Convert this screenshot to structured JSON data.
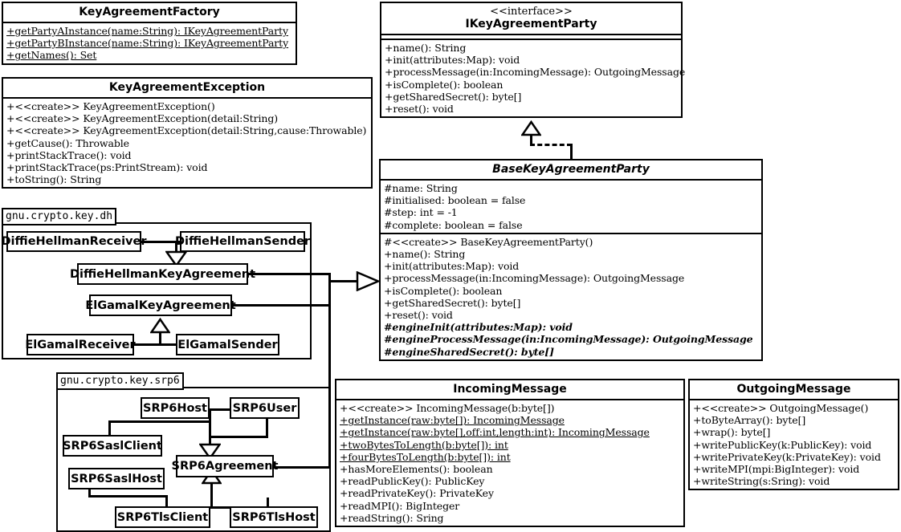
{
  "diagram": {
    "title": "GNU Crypto key agreement UML class diagram"
  },
  "classes": {
    "key_agreement_factory": {
      "name": "KeyAgreementFactory",
      "operations": [
        "+getPartyAInstance(name:String): IKeyAgreementParty",
        "+getPartyBInstance(name:String): IKeyAgreementParty",
        "+getNames(): Set"
      ]
    },
    "key_agreement_exception": {
      "name": "KeyAgreementException",
      "operations": [
        "+<<create>> KeyAgreementException()",
        "+<<create>> KeyAgreementException(detail:String)",
        "+<<create>> KeyAgreementException(detail:String,cause:Throwable)",
        "+getCause(): Throwable",
        "+printStackTrace(): void",
        "+printStackTrace(ps:PrintStream): void",
        "+toString(): String"
      ]
    },
    "ikey_agreement_party": {
      "stereotype": "<<interface>>",
      "name": "IKeyAgreementParty",
      "operations": [
        "+name(): String",
        "+init(attributes:Map): void",
        "+processMessage(in:IncomingMessage): OutgoingMessage",
        "+isComplete(): boolean",
        "+getSharedSecret(): byte[]",
        "+reset(): void"
      ]
    },
    "base_key_agreement_party": {
      "name": "BaseKeyAgreementParty",
      "attributes": [
        "#name: String",
        "#initialised: boolean = false",
        "#step: int = -1",
        "#complete: boolean = false"
      ],
      "operations": [
        "#<<create>> BaseKeyAgreementParty()",
        "+name(): String",
        "+init(attributes:Map): void",
        "+processMessage(in:IncomingMessage): OutgoingMessage",
        "+isComplete(): boolean",
        "+getSharedSecret(): byte[]",
        "+reset(): void",
        "#engineInit(attributes:Map): void",
        "#engineProcessMessage(in:IncomingMessage): OutgoingMessage",
        "#engineSharedSecret(): byte[]"
      ]
    },
    "incoming_message": {
      "name": "IncomingMessage",
      "operations": [
        "+<<create>> IncomingMessage(b:byte[])",
        "+getInstance(raw:byte[]): IncomingMessage",
        "+getInstance(raw:byte[],off:int,length:int): IncomingMessage",
        "+twoBytesToLength(b:byte[]): int",
        "+fourBytesToLength(b:byte[]): int",
        "+hasMoreElements(): boolean",
        "+readPublicKey(): PublicKey",
        "+readPrivateKey(): PrivateKey",
        "+readMPI(): BigInteger",
        "+readString(): Sring"
      ]
    },
    "outgoing_message": {
      "name": "OutgoingMessage",
      "operations": [
        "+<<create>> OutgoingMessage()",
        "+toByteArray(): byte[]",
        "+wrap(): byte[]",
        "+writePublicKey(k:PublicKey): void",
        "+writePrivateKey(k:PrivateKey): void",
        "+writeMPI(mpi:BigInteger): void",
        "+writeString(s:Sring): void"
      ]
    }
  },
  "packages": {
    "dh": {
      "label": "gnu.crypto.key.dh",
      "classes": {
        "diffie_hellman_receiver": "DiffieHellmanReceiver",
        "diffie_hellman_sender": "DiffieHellmanSender",
        "diffie_hellman_key_agreement": "DiffieHellmanKeyAgreement",
        "elgamal_key_agreement": "ElGamalKeyAgreement",
        "elgamal_receiver": "ElGamalReceiver",
        "elgamal_sender": "ElGamalSender"
      }
    },
    "srp6": {
      "label": "gnu.crypto.key.srp6",
      "classes": {
        "srp6_host": "SRP6Host",
        "srp6_user": "SRP6User",
        "srp6_sasl_client": "SRP6SaslClient",
        "srp6_sasl_host": "SRP6SaslHost",
        "srp6_agreement": "SRP6Agreement",
        "srp6_tls_client": "SRP6TlsClient",
        "srp6_tls_host": "SRP6TlsHost"
      }
    }
  },
  "colors": {
    "line": "#000000",
    "background": "#ffffff"
  }
}
